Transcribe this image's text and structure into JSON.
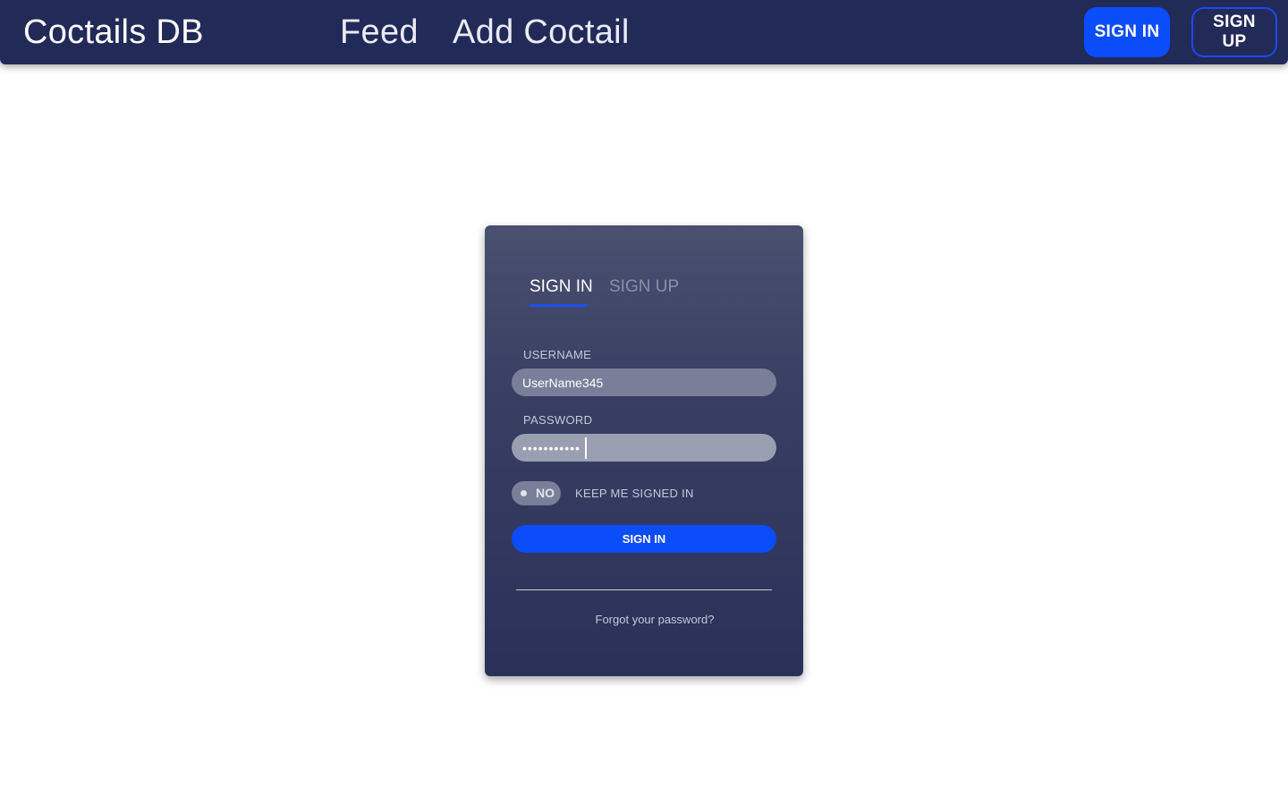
{
  "navbar": {
    "brand": "Coctails DB",
    "links": [
      "Feed",
      "Add Coctail"
    ],
    "sign_in_label": "SIGN IN",
    "sign_up_label": "SIGN UP"
  },
  "auth_card": {
    "tabs": [
      {
        "label": "SIGN IN",
        "active": true
      },
      {
        "label": "SIGN UP",
        "active": false
      }
    ],
    "username": {
      "label": "USERNAME",
      "value": "UserName345"
    },
    "password": {
      "label": "PASSWORD",
      "masked_value": "•••••••••••"
    },
    "keep_signed_in": {
      "toggle_text": "NO",
      "label": "KEEP ME SIGNED IN",
      "checked": false
    },
    "submit_label": "SIGN IN",
    "forgot_link": "Forgot your password?"
  },
  "colors": {
    "navbar_bg": "#222a58",
    "accent": "#0b4dfb",
    "card_top": "#4a506f",
    "card_bottom": "#2a3058"
  }
}
